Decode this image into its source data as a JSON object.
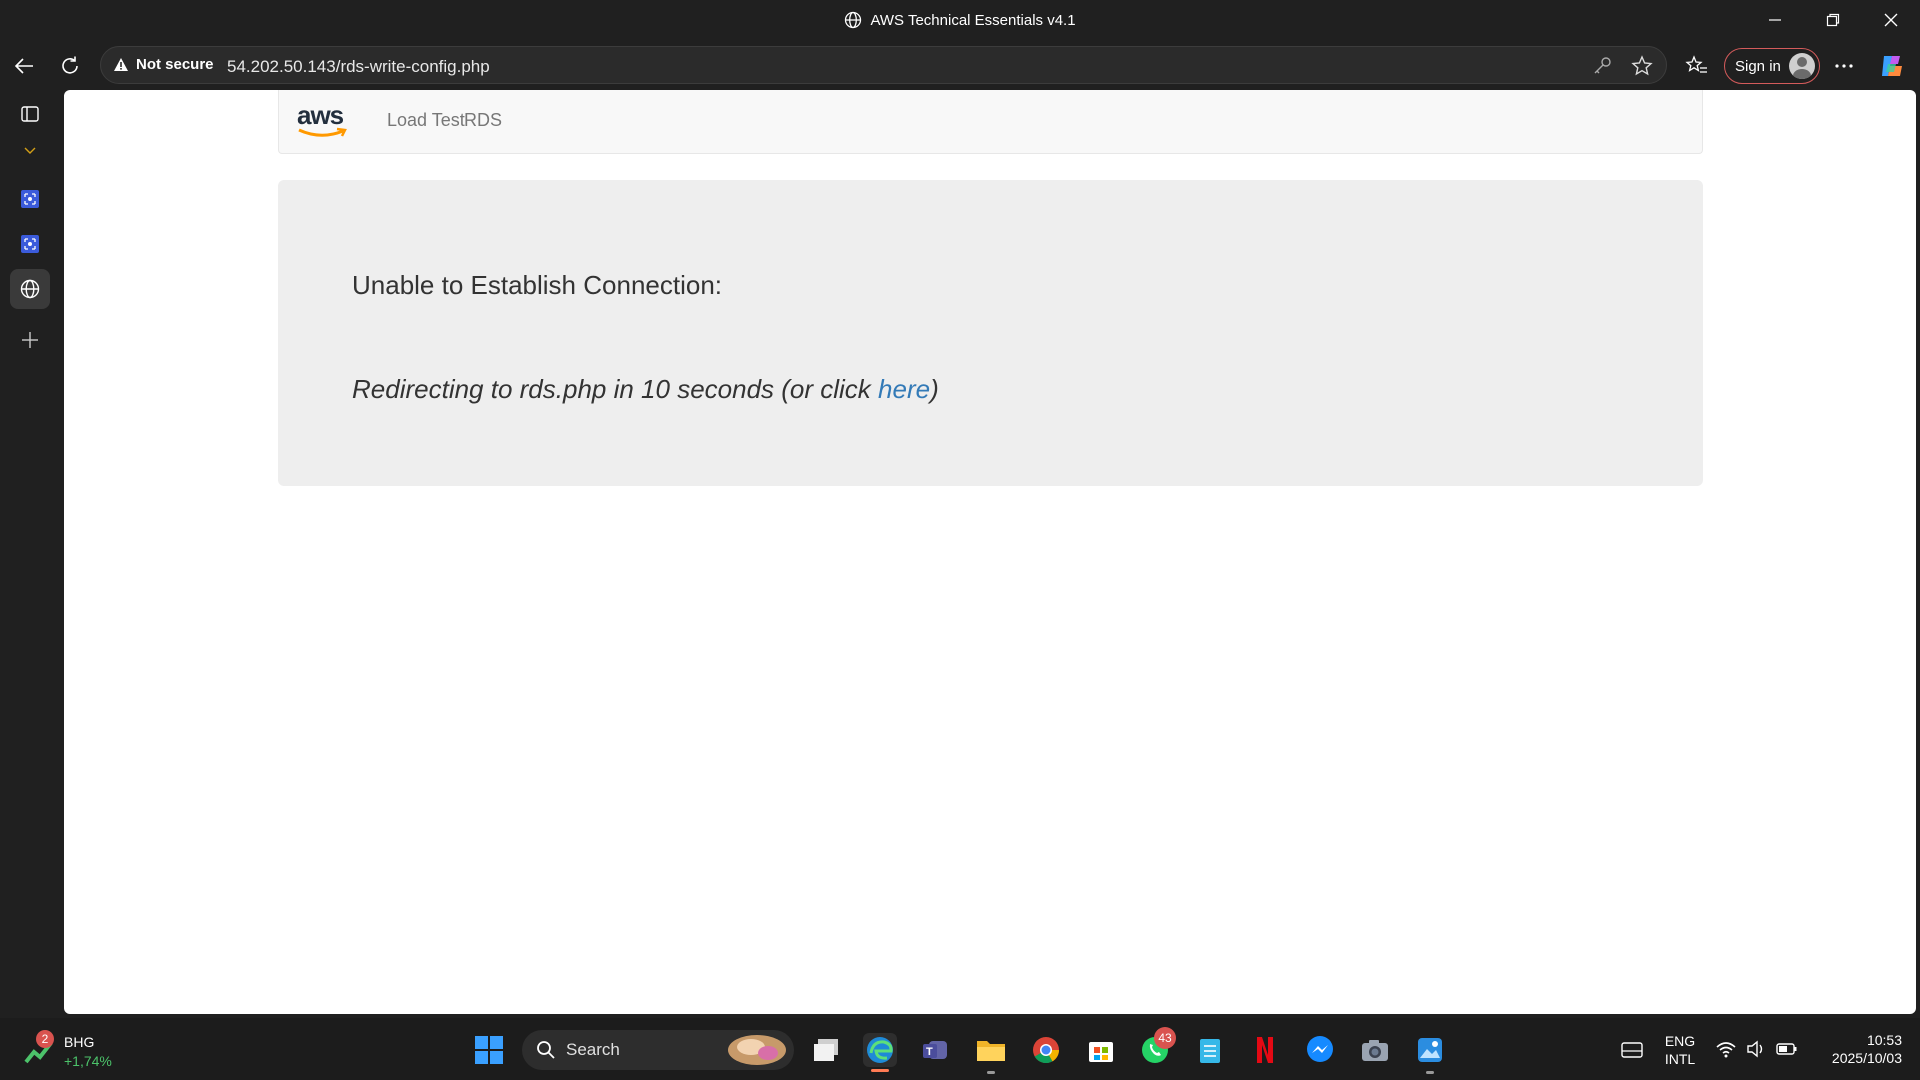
{
  "window": {
    "title": "AWS Technical Essentials v4.1"
  },
  "addressbar": {
    "security_label": "Not secure",
    "url": "54.202.50.143/rds-write-config.php",
    "signin_label": "Sign in"
  },
  "page": {
    "nav": {
      "logo_text": "aws",
      "links": [
        "Load Test",
        "RDS"
      ]
    },
    "heading": "Unable to Establish Connection:",
    "redirect_prefix": "Redirecting to rds.php in 10 seconds (or click ",
    "redirect_link": "here",
    "redirect_suffix": ")"
  },
  "taskbar": {
    "stock": {
      "ticker": "BHG",
      "change": "+1,74%",
      "badge": "2"
    },
    "search_placeholder": "Search",
    "whatsapp_badge": "43",
    "language": "ENG",
    "layout": "INTL",
    "time": "10:53",
    "date": "2025/10/03"
  },
  "colors": {
    "chrome_bg": "#202020",
    "link": "#337ab7",
    "jumbotron": "#eeeeee",
    "stock_up": "#4cc26a"
  }
}
